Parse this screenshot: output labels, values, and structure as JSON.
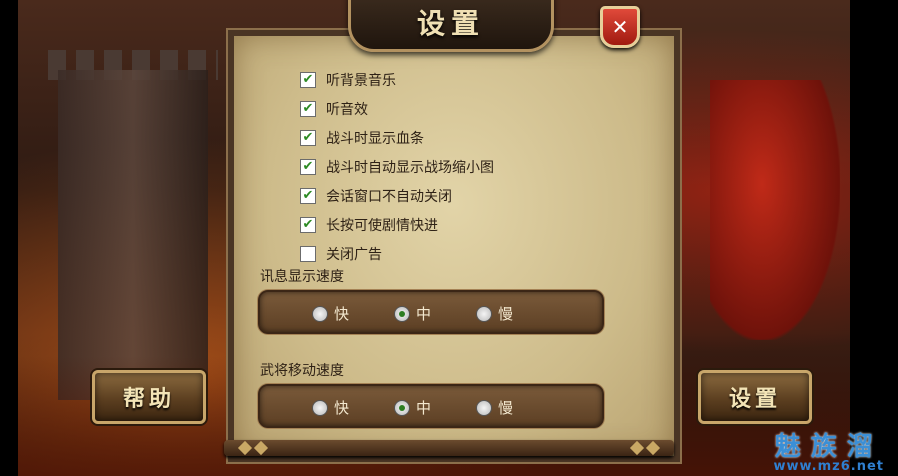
{
  "dialog": {
    "title": "设置",
    "close_icon": "close-x-icon"
  },
  "options": [
    {
      "label": "听背景音乐",
      "checked": true
    },
    {
      "label": "听音效",
      "checked": true
    },
    {
      "label": "战斗时显示血条",
      "checked": true
    },
    {
      "label": "战斗时自动显示战场缩小图",
      "checked": true
    },
    {
      "label": "会话窗口不自动关闭",
      "checked": true
    },
    {
      "label": "长按可使剧情快进",
      "checked": true
    },
    {
      "label": "关闭广告",
      "checked": false
    }
  ],
  "message_speed": {
    "label": "讯息显示速度",
    "options": [
      "快",
      "中",
      "慢"
    ],
    "selected": "中"
  },
  "move_speed": {
    "label": "武将移动速度",
    "options": [
      "快",
      "中",
      "慢"
    ],
    "selected": "中"
  },
  "buttons": {
    "help": "帮助",
    "settings": "设置"
  },
  "watermark": {
    "text": "魅族溜",
    "url": "www.mz6.net"
  },
  "colors": {
    "check": "#2c8a23",
    "panel": "#cdbb8a",
    "title_text": "#f0e0b4"
  }
}
